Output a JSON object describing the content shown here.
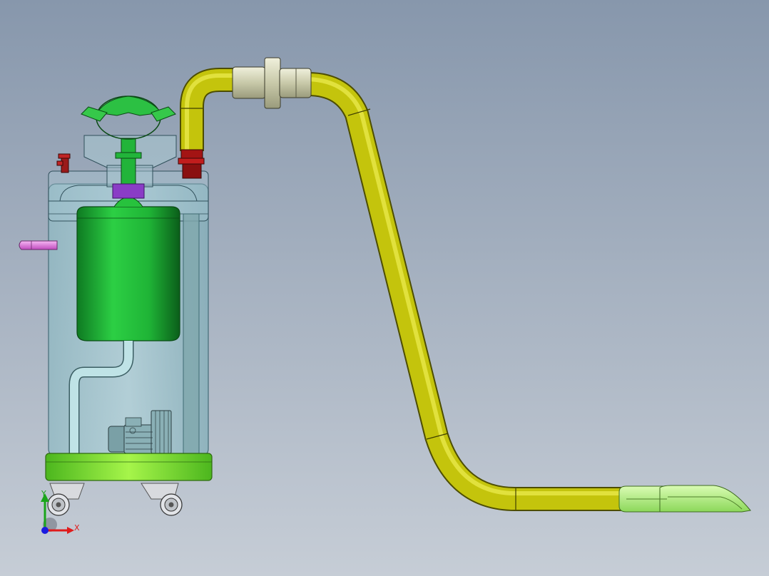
{
  "viewport": {
    "background_top": "#8797ac",
    "background_bottom": "#c6cdd6"
  },
  "colors": {
    "hose": "#c8c80a",
    "hose_dark": "#6e6e00",
    "tank_green": "#1fb436",
    "tank_green_dark": "#0e6b1e",
    "base_green": "#8fe63a",
    "glass": "#9ec6cf",
    "purple": "#8a3cc6",
    "pink": "#e27fe0",
    "valve_red": "#8a1010",
    "coupling": "#cfd0b4",
    "nozzle": "#b6f088"
  },
  "triad": {
    "x_label": "X",
    "y_label": "Y",
    "x_color": "#e01b1b",
    "y_color": "#1aa51a",
    "z_color": "#1b1be0"
  },
  "parts": [
    "vacuum-tank",
    "inner-filter-cylinder",
    "lid-handle",
    "motor",
    "casters",
    "inlet-valve",
    "suction-hose",
    "hose-coupling",
    "floor-nozzle"
  ]
}
